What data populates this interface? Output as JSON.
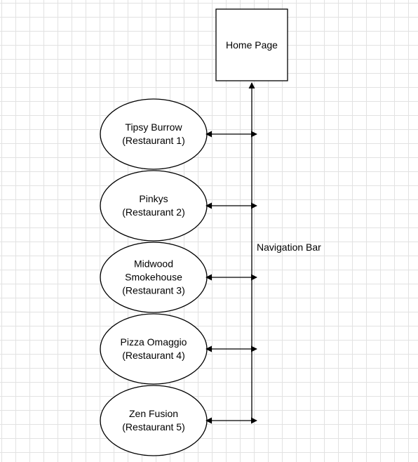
{
  "home": {
    "label": "Home Page"
  },
  "navigation": {
    "label": "Navigation Bar"
  },
  "restaurants": [
    {
      "name_lines": [
        "Tipsy Burrow"
      ],
      "tag": "(Restaurant 1)"
    },
    {
      "name_lines": [
        "Pinkys"
      ],
      "tag": "(Restaurant 2)"
    },
    {
      "name_lines": [
        "Midwood",
        "Smokehouse"
      ],
      "tag": "(Restaurant 3)"
    },
    {
      "name_lines": [
        "Pizza Omaggio"
      ],
      "tag": "(Restaurant 4)"
    },
    {
      "name_lines": [
        "Zen Fusion"
      ],
      "tag": "(Restaurant 5)"
    }
  ]
}
